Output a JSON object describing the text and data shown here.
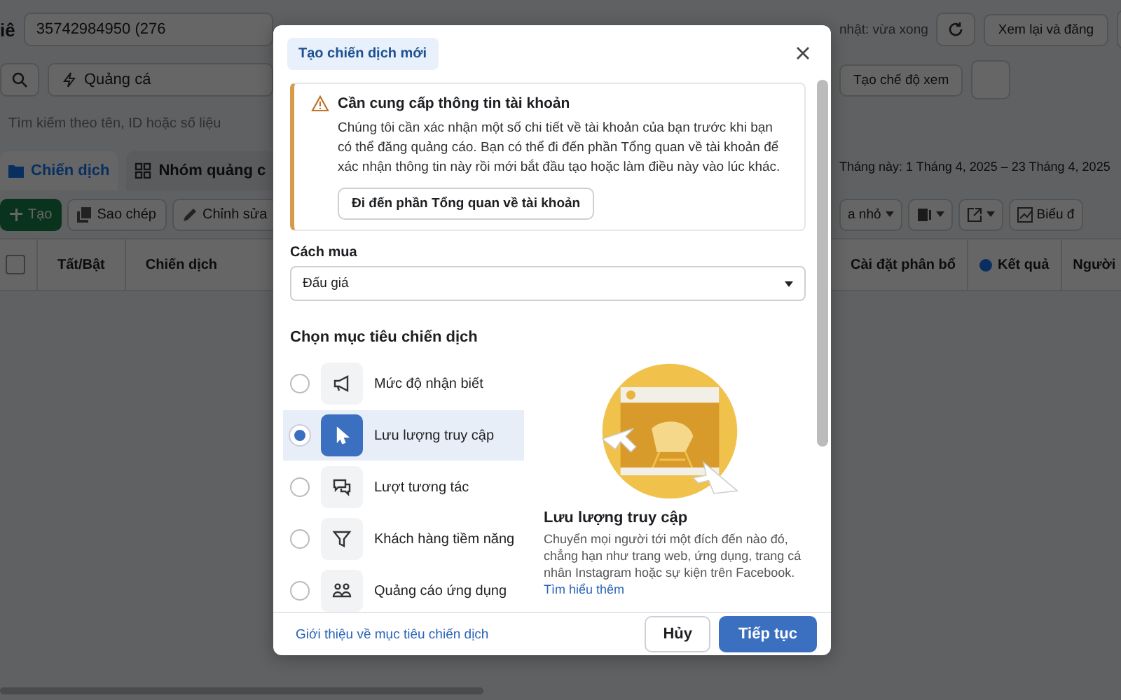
{
  "background": {
    "title_fragment": "iê",
    "account": "35742984950 (276",
    "update_status": "nhật: vừa xong",
    "review_button": "Xem lại và đăng",
    "quick_button": "Quảng cá",
    "create_view_button": "Tạo chế độ xem",
    "search": {
      "placeholder": "Tìm kiếm theo tên, ID hoặc số liệu"
    },
    "tabs": [
      {
        "label": "Chiến dịch",
        "selected": true
      },
      {
        "label": "Nhóm quảng c",
        "selected": false
      }
    ],
    "date_range": "Tháng này: 1 Tháng 4, 2025 – 23 Tháng 4, 2025",
    "toolbar_left": [
      {
        "label": "Tạo",
        "kind": "create"
      },
      {
        "label": "Sao chép",
        "kind": "copy"
      },
      {
        "label": "Chỉnh sửa",
        "kind": "edit"
      }
    ],
    "toolbar_right": {
      "dropdown": "a nhỏ",
      "chart_button": "Biểu đ"
    },
    "select_all": {
      "checked": false
    },
    "columns_left": [
      "Tất/Bật",
      "Chiến dịch"
    ],
    "columns_right": [
      {
        "label": "Cài đặt phân bổ",
        "kind": "plain"
      },
      {
        "label": "Kết quả",
        "kind": "metric"
      },
      {
        "label": "Người",
        "kind": "plain"
      }
    ]
  },
  "modal": {
    "title": "Tạo chiến dịch mới",
    "warning": {
      "title": "Cần cung cấp thông tin tài khoản",
      "text": "Chúng tôi cần xác nhận một số chi tiết về tài khoản của bạn trước khi bạn có thể đăng quảng cáo. Bạn có thể đi đến phần Tổng quan về tài khoản để xác nhận thông tin này rồi mới bắt đầu tạo hoặc làm điều này vào lúc khác.",
      "button": "Đi đến phần Tổng quan về tài khoản"
    },
    "buying_type": {
      "label": "Cách mua",
      "value": "Đấu giá"
    },
    "objective_heading": "Chọn mục tiêu chiến dịch",
    "objectives": [
      {
        "label": "Mức độ nhận biết",
        "kind": "awareness",
        "selected": false
      },
      {
        "label": "Lưu lượng truy cập",
        "kind": "traffic",
        "selected": true
      },
      {
        "label": "Lượt tương tác",
        "kind": "engagement",
        "selected": false
      },
      {
        "label": "Khách hàng tiềm năng",
        "kind": "leads",
        "selected": false
      },
      {
        "label": "Quảng cáo ứng dụng",
        "kind": "app",
        "selected": false
      }
    ],
    "detail": {
      "title": "Lưu lượng truy cập",
      "text": "Chuyển mọi người tới một đích đến nào đó, chẳng hạn như trang web, ứng dụng, trang cá nhân Instagram hoặc sự kiện trên Facebook.",
      "link": "Tìm hiểu thêm"
    },
    "footer_link": "Giới thiệu về mục tiêu chiến dịch",
    "buttons": [
      {
        "label": "Hủy",
        "kind": "secondary"
      },
      {
        "label": "Tiếp tục",
        "kind": "primary"
      }
    ]
  }
}
